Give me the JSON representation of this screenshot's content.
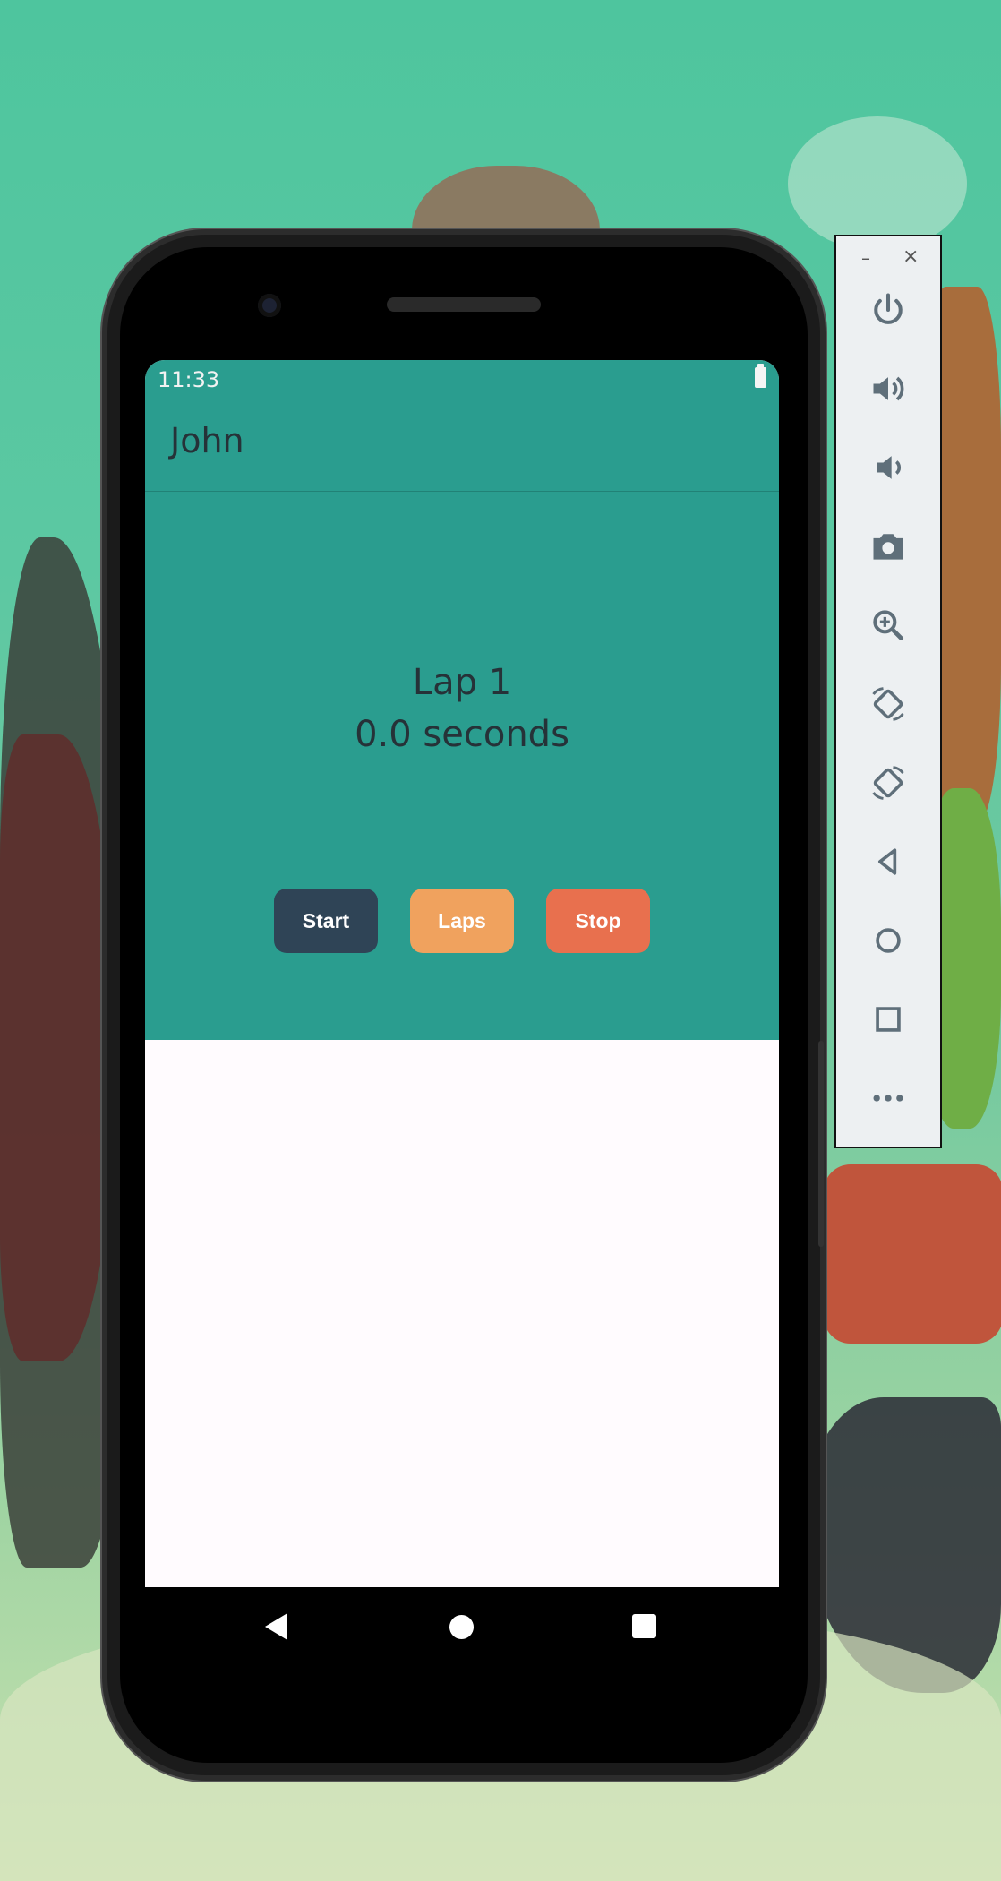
{
  "status_bar": {
    "time": "11:33"
  },
  "app_bar": {
    "title": "John"
  },
  "timer": {
    "lap_label": "Lap 1",
    "time_label": "0.0 seconds"
  },
  "buttons": {
    "start_label": "Start",
    "laps_label": "Laps",
    "stop_label": "Stop"
  },
  "colors": {
    "primary": "#2a9d8f",
    "start": "#2f4456",
    "laps": "#f0a25e",
    "stop": "#e8704e",
    "text": "#263238"
  },
  "navigation": {
    "icons": [
      "back-icon",
      "home-icon",
      "recents-icon"
    ]
  },
  "emulator_toolbar": {
    "window_controls": [
      "minimize-icon",
      "close-icon"
    ],
    "icons": [
      "power-icon",
      "volume-up-icon",
      "volume-down-icon",
      "screenshot-icon",
      "zoom-icon",
      "rotate-left-icon",
      "rotate-right-icon",
      "back-icon",
      "home-icon",
      "overview-icon",
      "more-icon"
    ]
  }
}
